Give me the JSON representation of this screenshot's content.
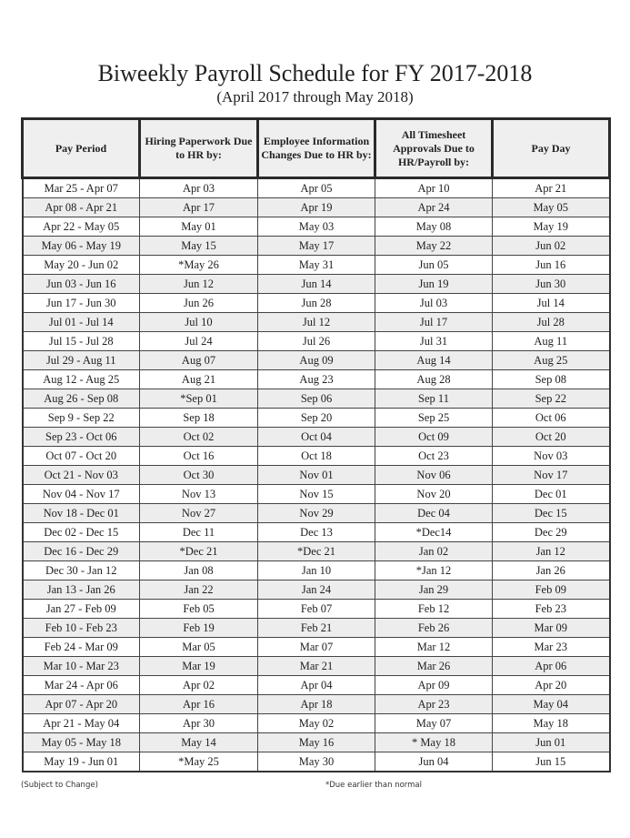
{
  "document": {
    "title": "Biweekly Payroll Schedule for FY 2017-2018",
    "subtitle": "(April 2017 through May 2018)"
  },
  "table": {
    "headers": [
      "Pay Period",
      "Hiring Paperwork Due to HR by:",
      "Employee Information Changes Due to HR by:",
      "All Timesheet Approvals Due to HR/Payroll by:",
      "Pay Day"
    ],
    "rows": [
      [
        "Mar 25 - Apr 07",
        "Apr 03",
        "Apr 05",
        "Apr 10",
        "Apr 21"
      ],
      [
        "Apr 08 - Apr 21",
        "Apr 17",
        "Apr 19",
        "Apr 24",
        "May 05"
      ],
      [
        "Apr 22 - May 05",
        "May 01",
        "May 03",
        "May 08",
        "May 19"
      ],
      [
        "May 06 - May 19",
        "May 15",
        "May 17",
        "May 22",
        "Jun 02"
      ],
      [
        "May 20 - Jun 02",
        "*May 26",
        "May 31",
        "Jun 05",
        "Jun 16"
      ],
      [
        "Jun 03 - Jun 16",
        "Jun 12",
        "Jun 14",
        "Jun 19",
        "Jun 30"
      ],
      [
        "Jun 17 - Jun 30",
        "Jun 26",
        "Jun 28",
        "Jul 03",
        "Jul 14"
      ],
      [
        "Jul 01 - Jul 14",
        "Jul 10",
        "Jul 12",
        "Jul 17",
        "Jul 28"
      ],
      [
        "Jul 15 - Jul 28",
        "Jul 24",
        "Jul 26",
        "Jul 31",
        "Aug 11"
      ],
      [
        "Jul 29 - Aug 11",
        "Aug 07",
        "Aug 09",
        "Aug 14",
        "Aug 25"
      ],
      [
        "Aug 12 - Aug 25",
        "Aug 21",
        "Aug 23",
        "Aug 28",
        "Sep 08"
      ],
      [
        "Aug 26 - Sep 08",
        "*Sep 01",
        "Sep 06",
        "Sep 11",
        "Sep 22"
      ],
      [
        "Sep 9 - Sep 22",
        "Sep 18",
        "Sep 20",
        "Sep 25",
        "Oct 06"
      ],
      [
        "Sep 23 - Oct 06",
        "Oct 02",
        "Oct 04",
        "Oct 09",
        "Oct 20"
      ],
      [
        "Oct 07 - Oct 20",
        "Oct 16",
        "Oct 18",
        "Oct 23",
        "Nov 03"
      ],
      [
        "Oct 21 - Nov 03",
        "Oct 30",
        "Nov 01",
        "Nov 06",
        "Nov 17"
      ],
      [
        "Nov 04 - Nov 17",
        "Nov 13",
        "Nov 15",
        "Nov 20",
        "Dec 01"
      ],
      [
        "Nov 18 - Dec 01",
        "Nov 27",
        "Nov 29",
        "Dec 04",
        "Dec 15"
      ],
      [
        "Dec 02 - Dec 15",
        "Dec 11",
        "Dec 13",
        "*Dec14",
        "Dec 29"
      ],
      [
        "Dec 16 - Dec 29",
        "*Dec 21",
        "*Dec 21",
        "Jan 02",
        "Jan 12"
      ],
      [
        "Dec 30 - Jan 12",
        "Jan 08",
        "Jan 10",
        "*Jan 12",
        "Jan 26"
      ],
      [
        "Jan 13 - Jan 26",
        "Jan 22",
        "Jan 24",
        "Jan 29",
        "Feb 09"
      ],
      [
        "Jan 27 - Feb 09",
        "Feb 05",
        "Feb 07",
        "Feb 12",
        "Feb 23"
      ],
      [
        "Feb 10  - Feb 23",
        "Feb 19",
        "Feb 21",
        "Feb 26",
        "Mar 09"
      ],
      [
        "Feb 24  - Mar 09",
        "Mar 05",
        "Mar 07",
        "Mar 12",
        "Mar 23"
      ],
      [
        "Mar 10  - Mar 23",
        "Mar 19",
        "Mar 21",
        "Mar 26",
        "Apr 06"
      ],
      [
        "Mar 24  - Apr 06",
        "Apr 02",
        "Apr 04",
        "Apr 09",
        "Apr 20"
      ],
      [
        "Apr 07 - Apr 20",
        "Apr 16",
        "Apr 18",
        "Apr 23",
        "May 04"
      ],
      [
        "Apr 21 - May 04",
        "Apr 30",
        "May 02",
        "May 07",
        "May 18"
      ],
      [
        "May 05 - May 18",
        "May 14",
        "May 16",
        "* May 18",
        "Jun 01"
      ],
      [
        "May 19 - Jun 01",
        "*May 25",
        "May 30",
        "Jun 04",
        "Jun 15"
      ]
    ]
  },
  "footnotes": {
    "left": "(Subject to Change)",
    "right": "*Due earlier than normal"
  }
}
